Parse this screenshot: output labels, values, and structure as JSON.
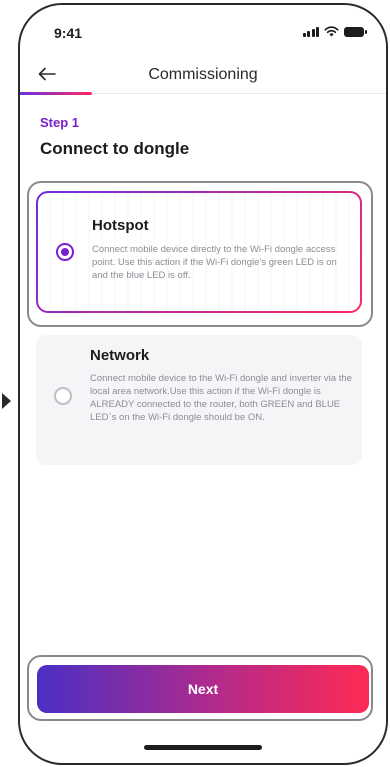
{
  "status_bar": {
    "time": "9:41",
    "icons": [
      "signal-icon",
      "wifi-icon",
      "battery-icon"
    ]
  },
  "nav": {
    "back_icon": "arrow-left-icon",
    "title": "Commissioning",
    "progress_fraction": 0.2
  },
  "step": {
    "label": "Step 1",
    "title": "Connect to dongle"
  },
  "options": [
    {
      "title": "Hotspot",
      "description": "Connect mobile device directly to the Wi-Fi dongle access point. Use this action if the Wi-Fi dongle’s green LED is on and the blue LED is off.",
      "selected": true
    },
    {
      "title": "Network",
      "description": "Connect mobile device to the Wi-Fi dongle and inverter via the local area network.Use this action if the Wi-Fi dongle is ALREADY connected to the router, both GREEN and BLUE LED`s on the Wi-Fi dongle should be ON.",
      "selected": false
    }
  ],
  "next_button": {
    "label": "Next"
  },
  "colors": {
    "accent": "#7a20c9",
    "gradient_start": "#4a2fc4",
    "gradient_end": "#ff2a55"
  }
}
